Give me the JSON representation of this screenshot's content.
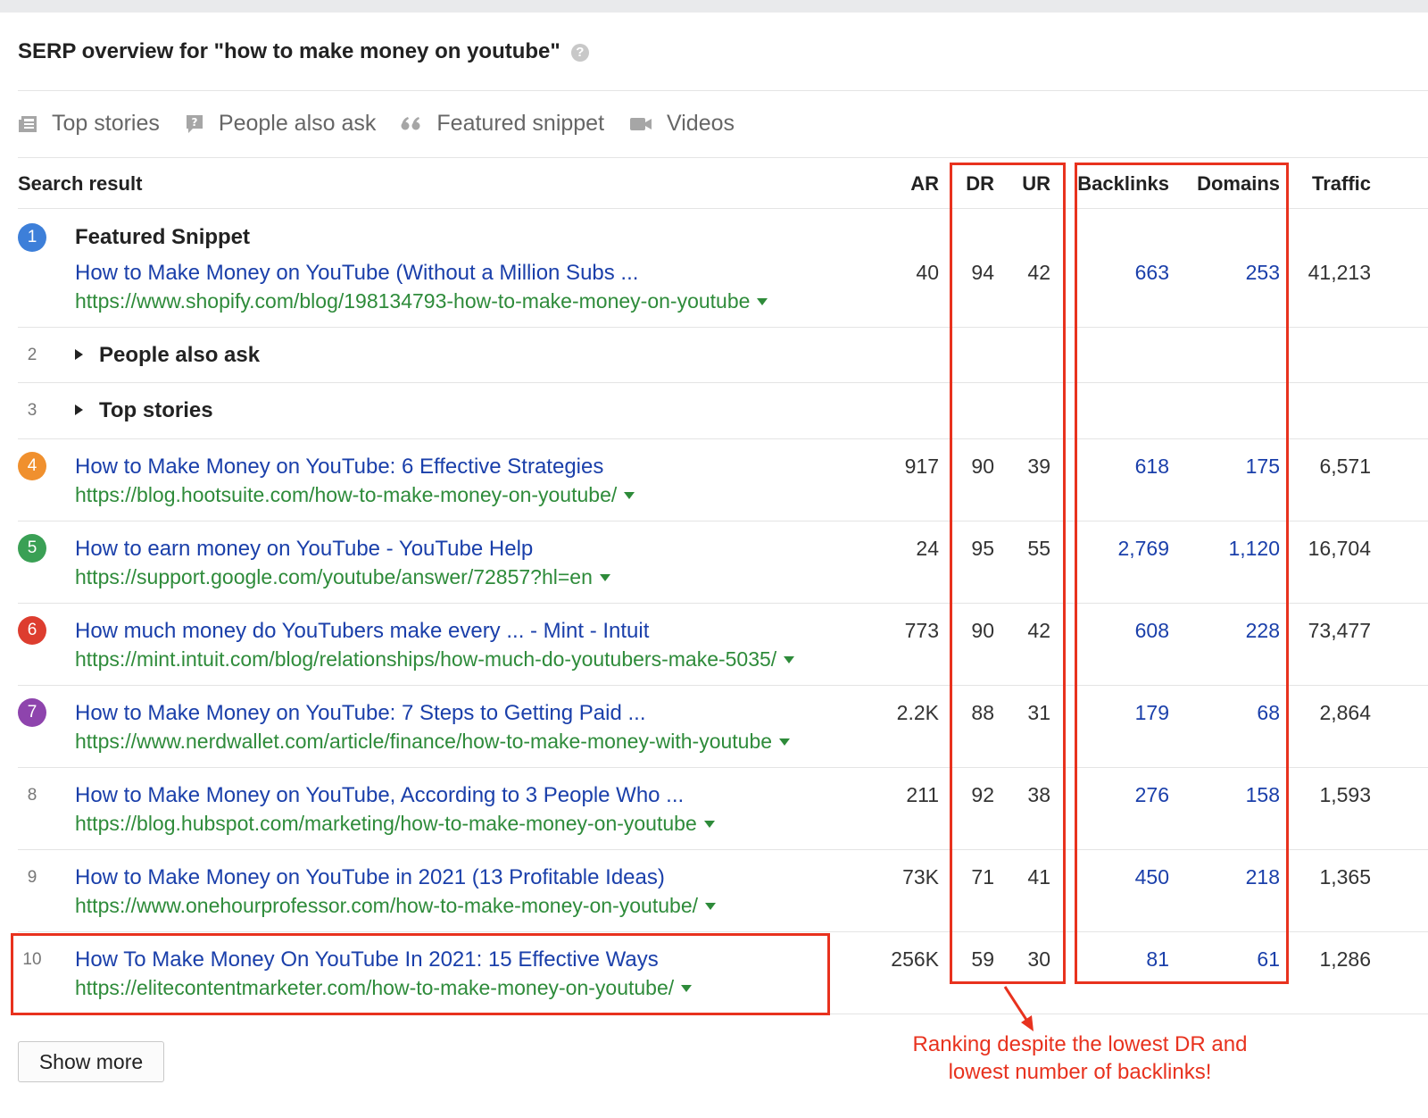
{
  "header": {
    "title": "SERP overview for \"how to make money on youtube\"",
    "help_icon": "?"
  },
  "features": [
    {
      "icon": "newspaper-icon",
      "label": "Top stories"
    },
    {
      "icon": "question-bubble-icon",
      "label": "People also ask"
    },
    {
      "icon": "quote-icon",
      "label": "Featured snippet"
    },
    {
      "icon": "video-camera-icon",
      "label": "Videos"
    }
  ],
  "columns": {
    "search_result": "Search result",
    "ar": "AR",
    "dr": "DR",
    "ur": "UR",
    "backlinks": "Backlinks",
    "domains": "Domains",
    "traffic": "Traffic"
  },
  "rows": [
    {
      "rank": "1",
      "badge_color": "#3d7fd9",
      "label": "Featured Snippet",
      "title": "How to Make Money on YouTube (Without a Million Subs ...",
      "url": "https://www.shopify.com/blog/198134793-how-to-make-money-on-youtube",
      "ar": "40",
      "dr": "94",
      "ur": "42",
      "backlinks": "663",
      "domains": "253",
      "traffic": "41,213"
    },
    {
      "rank": "2",
      "expander": "People also ask"
    },
    {
      "rank": "3",
      "expander": "Top stories"
    },
    {
      "rank": "4",
      "badge_color": "#f0902e",
      "title": "How to Make Money on YouTube: 6 Effective Strategies",
      "url": "https://blog.hootsuite.com/how-to-make-money-on-youtube/",
      "ar": "917",
      "dr": "90",
      "ur": "39",
      "backlinks": "618",
      "domains": "175",
      "traffic": "6,571"
    },
    {
      "rank": "5",
      "badge_color": "#3aa055",
      "title": "How to earn money on YouTube - YouTube Help",
      "url": "https://support.google.com/youtube/answer/72857?hl=en",
      "ar": "24",
      "dr": "95",
      "ur": "55",
      "backlinks": "2,769",
      "domains": "1,120",
      "traffic": "16,704"
    },
    {
      "rank": "6",
      "badge_color": "#dd3d2f",
      "title": "How much money do YouTubers make every ... - Mint - Intuit",
      "url": "https://mint.intuit.com/blog/relationships/how-much-do-youtubers-make-5035/",
      "ar": "773",
      "dr": "90",
      "ur": "42",
      "backlinks": "608",
      "domains": "228",
      "traffic": "73,477"
    },
    {
      "rank": "7",
      "badge_color": "#8e44ad",
      "title": "How to Make Money on YouTube: 7 Steps to Getting Paid ...",
      "url": "https://www.nerdwallet.com/article/finance/how-to-make-money-with-youtube",
      "ar": "2.2K",
      "dr": "88",
      "ur": "31",
      "backlinks": "179",
      "domains": "68",
      "traffic": "2,864"
    },
    {
      "rank": "8",
      "title": "How to Make Money on YouTube, According to 3 People Who ...",
      "url": "https://blog.hubspot.com/marketing/how-to-make-money-on-youtube",
      "ar": "211",
      "dr": "92",
      "ur": "38",
      "backlinks": "276",
      "domains": "158",
      "traffic": "1,593"
    },
    {
      "rank": "9",
      "title": "How to Make Money on YouTube in 2021 (13 Profitable Ideas)",
      "url": "https://www.onehourprofessor.com/how-to-make-money-on-youtube/",
      "ar": "73K",
      "dr": "71",
      "ur": "41",
      "backlinks": "450",
      "domains": "218",
      "traffic": "1,365"
    },
    {
      "rank": "10",
      "title": "How To Make Money On YouTube In 2021: 15 Effective Ways",
      "url": "https://elitecontentmarketer.com/how-to-make-money-on-youtube/",
      "ar": "256K",
      "dr": "59",
      "ur": "30",
      "backlinks": "81",
      "domains": "61",
      "traffic": "1,286"
    }
  ],
  "annotation": {
    "line1": "Ranking despite the lowest DR and",
    "line2": "lowest number of backlinks!",
    "color": "#e8321e"
  },
  "show_more_label": "Show more"
}
